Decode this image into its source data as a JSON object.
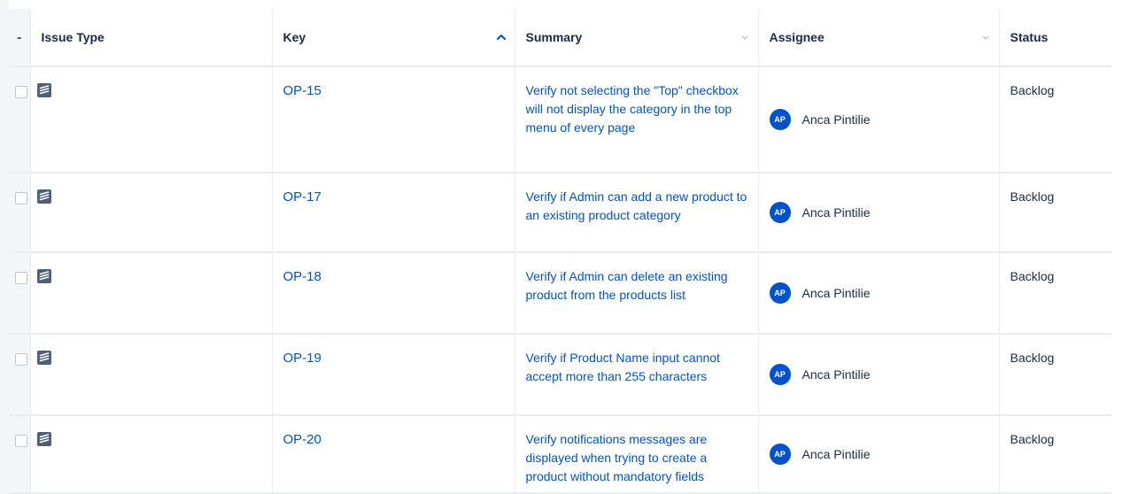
{
  "table": {
    "select_header": "-",
    "columns": {
      "issue_type": "Issue Type",
      "key": "Key",
      "summary": "Summary",
      "assignee": "Assignee",
      "status": "Status"
    },
    "rows": [
      {
        "type_icon": "test-issue-icon",
        "key": "OP-15",
        "summary": "Verify not selecting the \"Top\" checkbox will not display the category in the top menu of every page",
        "assignee_initials": "AP",
        "assignee": "Anca Pintilie",
        "status": "Backlog"
      },
      {
        "type_icon": "test-issue-icon",
        "key": "OP-17",
        "summary": "Verify if Admin can add a new product to an existing product category",
        "assignee_initials": "AP",
        "assignee": "Anca Pintilie",
        "status": "Backlog"
      },
      {
        "type_icon": "test-issue-icon",
        "key": "OP-18",
        "summary": "Verify if Admin can delete an existing product from the products list",
        "assignee_initials": "AP",
        "assignee": "Anca Pintilie",
        "status": "Backlog"
      },
      {
        "type_icon": "test-issue-icon",
        "key": "OP-19",
        "summary": "Verify if Product Name input cannot accept more than 255 characters",
        "assignee_initials": "AP",
        "assignee": "Anca Pintilie",
        "status": "Backlog"
      },
      {
        "type_icon": "test-issue-icon",
        "key": "OP-20",
        "summary": "Verify notifications messages are displayed when trying to create a product without mandatory fields",
        "assignee_initials": "AP",
        "assignee": "Anca Pintilie",
        "status": "Backlog"
      }
    ]
  },
  "colors": {
    "link": "#0052cc",
    "avatar_bg": "#0052cc",
    "border": "#ebecf0",
    "select_col_bg": "#f4f5f7"
  },
  "icons": {
    "sort": "chevron-up-icon",
    "column_menu": "chevron-down-icon"
  }
}
